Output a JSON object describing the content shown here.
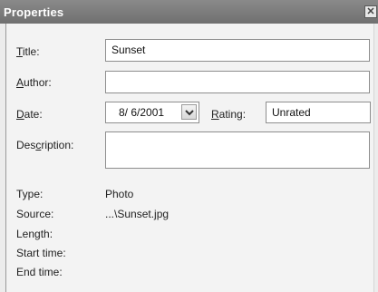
{
  "window": {
    "title": "Properties",
    "close_symbol": "✕"
  },
  "form": {
    "title_label_first": "T",
    "title_label_rest": "itle:",
    "title_value": "Sunset",
    "author_label_first": "A",
    "author_label_rest": "uthor:",
    "author_value": "",
    "date_label_first": "D",
    "date_label_rest": "ate:",
    "date_value": "8/ 6/2001",
    "rating_label_first": "R",
    "rating_label_rest": "ating:",
    "rating_value": "Unrated",
    "description_label_before": "Des",
    "description_label_under": "c",
    "description_label_after": "ription:",
    "description_value": ""
  },
  "info": {
    "type_label": "Type:",
    "type_value": "Photo",
    "source_label": "Source:",
    "source_value": "...\\Sunset.jpg",
    "length_label": "Length:",
    "length_value": "",
    "start_label": "Start time:",
    "start_value": "",
    "end_label": "End time:",
    "end_value": ""
  },
  "icons": {
    "close": "close-icon",
    "dropdown": "chevron-down-icon"
  }
}
